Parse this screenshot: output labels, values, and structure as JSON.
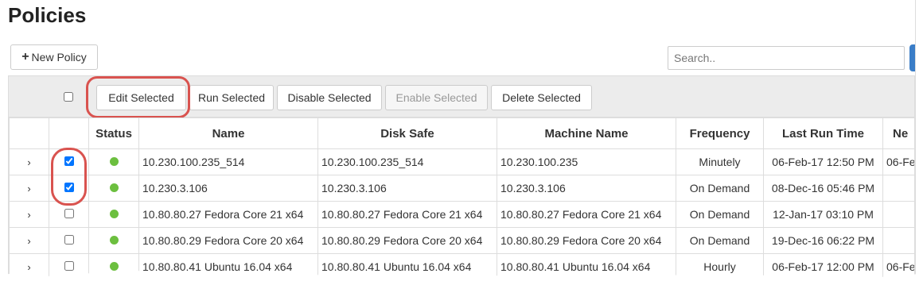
{
  "page": {
    "title": "Policies"
  },
  "toolbar": {
    "new_policy_label": "New Policy",
    "search_placeholder": "Search..",
    "edit_selected": "Edit Selected",
    "run_selected": "Run Selected",
    "disable_selected": "Disable Selected",
    "enable_selected": "Enable Selected",
    "delete_selected": "Delete Selected"
  },
  "table": {
    "columns": {
      "status": "Status",
      "name": "Name",
      "disk_safe": "Disk Safe",
      "machine_name": "Machine Name",
      "frequency": "Frequency",
      "last_run_time": "Last Run Time",
      "next": "Ne"
    },
    "rows": [
      {
        "checked": true,
        "name": "10.230.100.235_514",
        "disk_safe": "10.230.100.235_514",
        "machine": "10.230.100.235",
        "frequency": "Minutely",
        "last_run": "06-Feb-17 12:50 PM",
        "next": "06-Fe"
      },
      {
        "checked": true,
        "name": "10.230.3.106",
        "disk_safe": "10.230.3.106",
        "machine": "10.230.3.106",
        "frequency": "On Demand",
        "last_run": "08-Dec-16 05:46 PM",
        "next": ""
      },
      {
        "checked": false,
        "name": "10.80.80.27 Fedora Core 21 x64",
        "disk_safe": "10.80.80.27 Fedora Core 21 x64",
        "machine": "10.80.80.27 Fedora Core 21 x64",
        "frequency": "On Demand",
        "last_run": "12-Jan-17 03:10 PM",
        "next": ""
      },
      {
        "checked": false,
        "name": "10.80.80.29 Fedora Core 20 x64",
        "disk_safe": "10.80.80.29 Fedora Core 20 x64",
        "machine": "10.80.80.29 Fedora Core 20 x64",
        "frequency": "On Demand",
        "last_run": "19-Dec-16 06:22 PM",
        "next": ""
      },
      {
        "checked": false,
        "name": "10.80.80.41 Ubuntu 16.04 x64",
        "disk_safe": "10.80.80.41 Ubuntu 16.04 x64",
        "machine": "10.80.80.41 Ubuntu 16.04 x64",
        "frequency": "Hourly",
        "last_run": "06-Feb-17 12:00 PM",
        "next": "06-Fe"
      }
    ]
  },
  "icons": {
    "expand": "chevron-right-icon",
    "status": "status-dot-icon",
    "plus": "plus-icon"
  },
  "colors": {
    "status_ok": "#6cbf3f",
    "highlight": "#d9534f",
    "accent": "#3a7dc7"
  }
}
